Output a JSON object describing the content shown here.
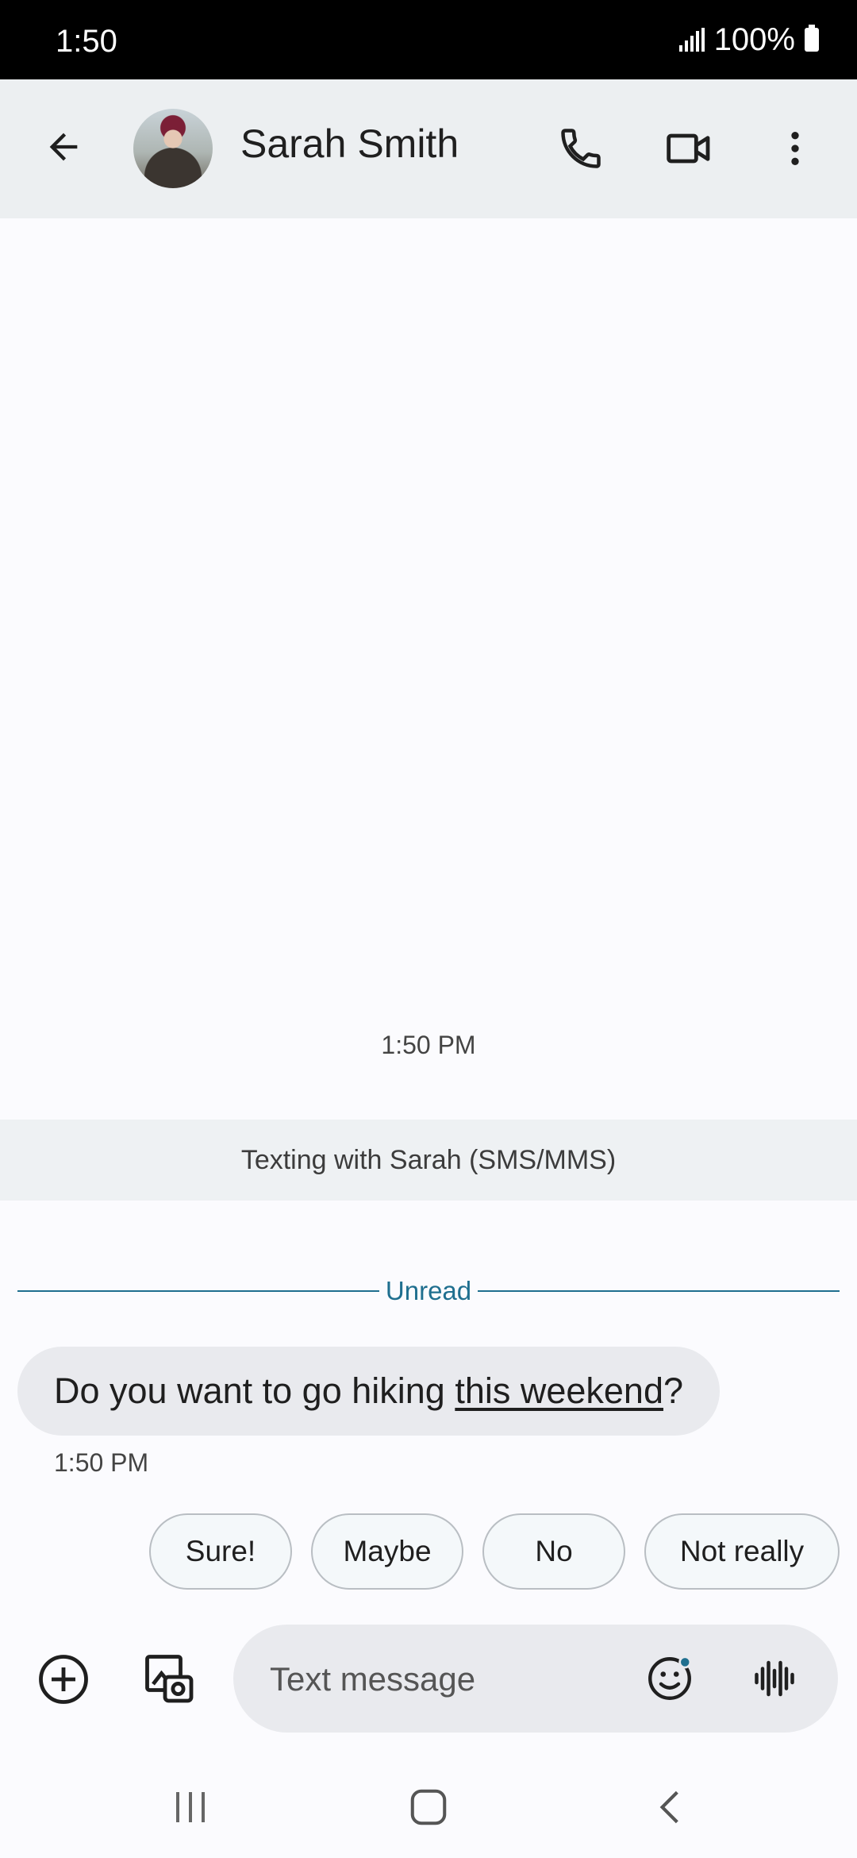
{
  "status_bar": {
    "time": "1:50",
    "battery": "100%"
  },
  "app_bar": {
    "contact_name": "Sarah Smith",
    "icons": {
      "back": "arrow-left-icon",
      "call": "phone-icon",
      "video": "video-camera-icon",
      "more": "more-vert-icon"
    }
  },
  "conversation": {
    "timestamp": "1:50 PM",
    "info_banner": "Texting with Sarah (SMS/MMS)",
    "unread_label": "Unread",
    "messages": [
      {
        "text_before": "Do you want to go hiking ",
        "link_text": "this weekend",
        "text_after": "?",
        "time": "1:50 PM"
      }
    ]
  },
  "suggestions": [
    "Sure!",
    "Maybe",
    "No",
    "Not really"
  ],
  "compose": {
    "placeholder": "Text message",
    "value": "",
    "icons": {
      "add": "add-circle-icon",
      "gallery": "gallery-icon",
      "emoji": "emoji-icon",
      "voice": "voice-wave-icon"
    }
  },
  "colors": {
    "accent": "#1f6f8f",
    "app_bar_bg": "#eceff1",
    "bubble_bg": "#e9eaee",
    "chip_bg": "#f4f8fa"
  }
}
